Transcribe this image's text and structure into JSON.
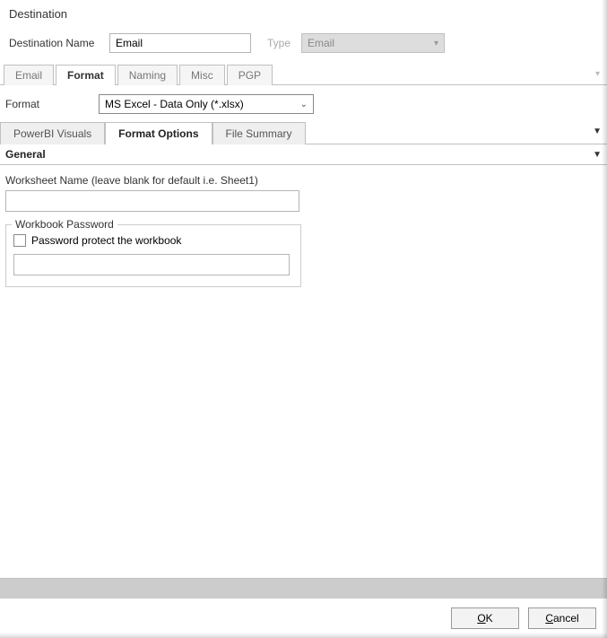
{
  "window": {
    "title": "Destination"
  },
  "header": {
    "name_label": "Destination Name",
    "name_value": "Email",
    "type_label": "Type",
    "type_value": "Email"
  },
  "tabs1": [
    {
      "label": "Email",
      "active": false
    },
    {
      "label": "Format",
      "active": true
    },
    {
      "label": "Naming",
      "active": false
    },
    {
      "label": "Misc",
      "active": false
    },
    {
      "label": "PGP",
      "active": false
    }
  ],
  "format": {
    "label": "Format",
    "value": "MS Excel - Data Only (*.xlsx)"
  },
  "tabs2": [
    {
      "label": "PowerBI Visuals",
      "active": false
    },
    {
      "label": "Format Options",
      "active": true
    },
    {
      "label": "File Summary",
      "active": false
    }
  ],
  "section": {
    "title": "General"
  },
  "worksheet": {
    "label": "Worksheet Name (leave blank for default i.e. Sheet1)",
    "value": ""
  },
  "password_group": {
    "legend": "Workbook Password",
    "checkbox_label": "Password protect the workbook",
    "checked": false,
    "value": ""
  },
  "buttons": {
    "ok": "OK",
    "cancel": "Cancel"
  }
}
